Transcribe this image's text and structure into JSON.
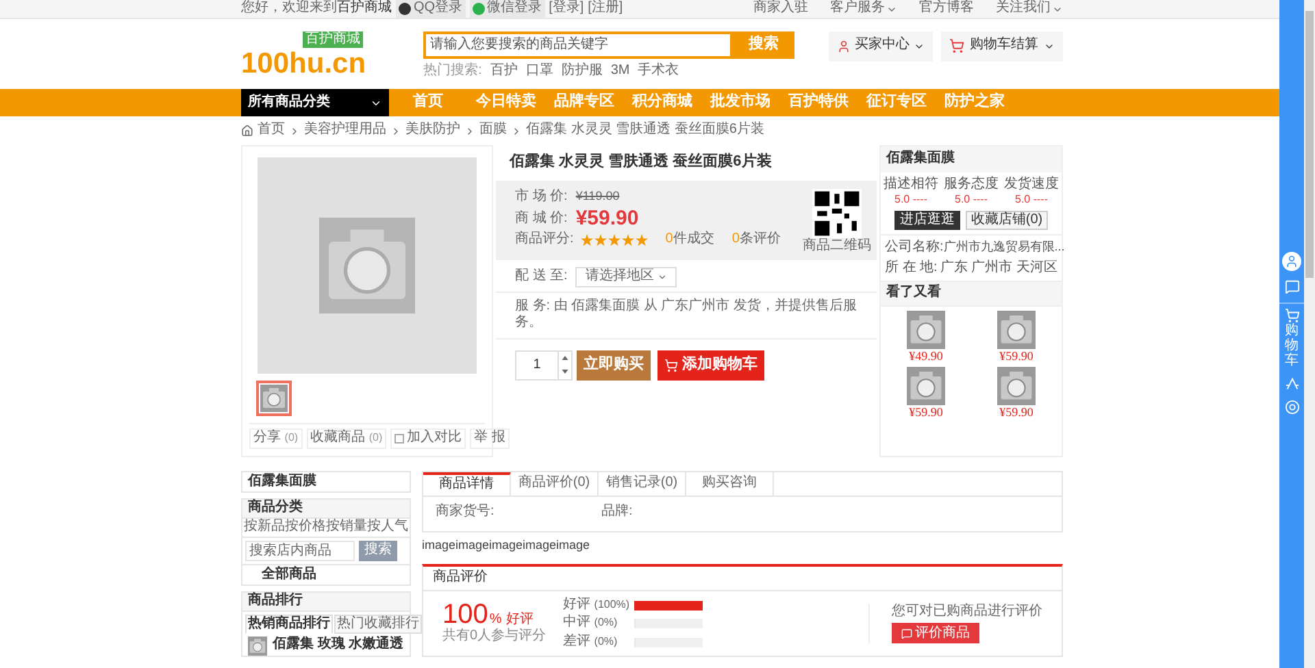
{
  "top_bar": {
    "greeting": "您好，欢迎来到",
    "site": "百护商城",
    "logins": [
      "QQ登录",
      "微信登录"
    ],
    "login": "[登录]",
    "register": "[注册]",
    "links": [
      {
        "label": "商家入驻",
        "dropdown": false
      },
      {
        "label": "客户服务",
        "dropdown": true
      },
      {
        "label": "官方博客",
        "dropdown": false
      },
      {
        "label": "关注我们",
        "dropdown": true
      }
    ]
  },
  "header": {
    "logo": "100hu.cn",
    "logo_badge": "百护商城",
    "search": {
      "placeholder": "请输入您要搜索的商品关键字",
      "button": "搜索"
    },
    "hot_label": "热门搜索:",
    "hot_terms": [
      "百护",
      "口罩",
      "防护服",
      "3M",
      "手术衣"
    ],
    "buyer_center": "买家中心",
    "cart": "购物车结算"
  },
  "nav": {
    "category": "所有商品分类",
    "items": [
      "首页",
      "今日特卖",
      "品牌专区",
      "积分商城",
      "批发市场",
      "百护特供",
      "征订专区",
      "防护之家"
    ]
  },
  "breadcrumb": [
    "首页",
    "美容护理用品",
    "美肤防护",
    "面膜",
    "佰露集 水灵灵 雪肤通透 蚕丝面膜6片装"
  ],
  "product": {
    "thumbnails": [
      {
        "selected": true
      }
    ],
    "actions": [
      {
        "kind": "link",
        "label": "分享",
        "count": "(0)"
      },
      {
        "kind": "link",
        "label": "收藏商品",
        "count": "(0)"
      },
      {
        "kind": "checkbox",
        "label": "加入对比",
        "checked": false
      }
    ],
    "report": "举 报",
    "title": "佰露集 水灵灵 雪肤通透 蚕丝面膜6片装",
    "market_label": "市 场 价:",
    "market_price": "¥119.00",
    "mall_label": "商 城 价:",
    "mall_price": "¥59.90",
    "rating_label": "商品评分:",
    "stars": 5,
    "sold_count": "0",
    "sold_label": "件成交",
    "review_count": "0",
    "review_label": "条评价",
    "qr_label": "商品二维码",
    "delivery_label": "配 送 至:",
    "delivery_select": "请选择地区",
    "service": "服 务: 由 佰露集面膜 从 广东广州市 发货，并提供售后服务。",
    "quantity": "1",
    "buy_now": "立即购买",
    "add_cart": "添加购物车"
  },
  "store": {
    "name": "佰露集面膜",
    "scores": [
      {
        "label": "描述相符",
        "value": "5.0 ----"
      },
      {
        "label": "服务态度",
        "value": "5.0 ----"
      },
      {
        "label": "发货速度",
        "value": "5.0 ----"
      }
    ],
    "enter": "进店逛逛",
    "favorite": "收藏店铺(0)",
    "company_label": "公司名称:",
    "company": "广州市九逸贸易有限...",
    "location_label": "所 在 地:",
    "location": "广东 广州市 天河区",
    "viewed_title": "看了又看",
    "viewed": [
      {
        "price": "¥49.90"
      },
      {
        "price": "¥59.90"
      },
      {
        "price": "¥59.90"
      },
      {
        "price": "¥59.90"
      }
    ]
  },
  "shop_side": {
    "name": "佰露集面膜",
    "category_title": "商品分类",
    "sorts": [
      "按新品",
      "按价格",
      "按销量",
      "按人气"
    ],
    "search_placeholder": "搜索店内商品",
    "search_button": "搜索",
    "all": "全部商品",
    "ranking_title": "商品排行",
    "ranking_tabs": [
      {
        "label": "热销商品排行",
        "selected": true
      },
      {
        "label": "热门收藏排行",
        "selected": false
      }
    ],
    "ranking_item": "佰露集 玫瑰 水嫩通透"
  },
  "detail": {
    "tabs": [
      {
        "label": "商品详情",
        "selected": true
      },
      {
        "label": "商品评价(0)",
        "selected": false
      },
      {
        "label": "销售记录(0)",
        "selected": false
      },
      {
        "label": "购买咨询",
        "selected": false
      }
    ],
    "fields": [
      "商家货号:",
      "品牌:"
    ],
    "body": "imageimageimageimageimage"
  },
  "reviews": {
    "title": "商品评价",
    "percent": "100",
    "percent_sign": "%",
    "good": "好评",
    "participants": "共有0人参与评分",
    "bars": [
      {
        "label": "好评",
        "reading": "(100%)",
        "level": 1
      },
      {
        "label": "中评",
        "reading": "(0%)",
        "level": 0
      },
      {
        "label": "差评",
        "reading": "(0%)",
        "level": 0
      }
    ],
    "prompt": "您可对已购商品进行评价",
    "button": "评价商品"
  },
  "sidebar": {
    "cart": "购物车"
  }
}
